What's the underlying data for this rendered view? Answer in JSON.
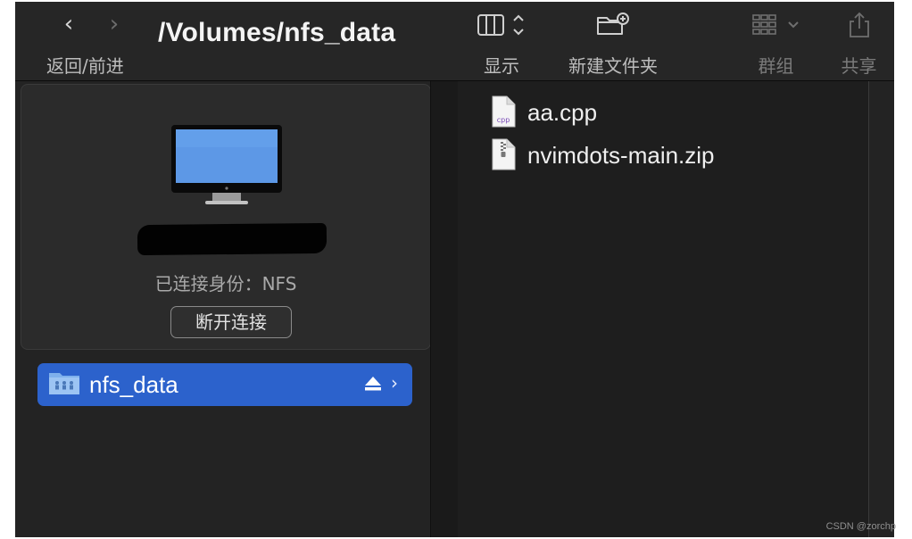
{
  "toolbar": {
    "nav_label": "返回/前进",
    "path_title": "/Volumes/nfs_data",
    "view_label": "显示",
    "new_folder_label": "新建文件夹",
    "group_label": "群组",
    "share_label": "共享"
  },
  "sidebar": {
    "server_card": {
      "connection_status": "已连接身份：NFS",
      "disconnect_label": "断开连接"
    },
    "shares": [
      {
        "label": "nfs_data",
        "selected": true
      }
    ]
  },
  "files": [
    {
      "name": "aa.cpp",
      "icon": "cpp-file-icon"
    },
    {
      "name": "nvimdots-main.zip",
      "icon": "zip-file-icon"
    }
  ],
  "watermark": "CSDN @zorchp",
  "colors": {
    "accent": "#2c62cc",
    "window_bg": "#1f1f1f",
    "toolbar_bg": "#262626"
  }
}
